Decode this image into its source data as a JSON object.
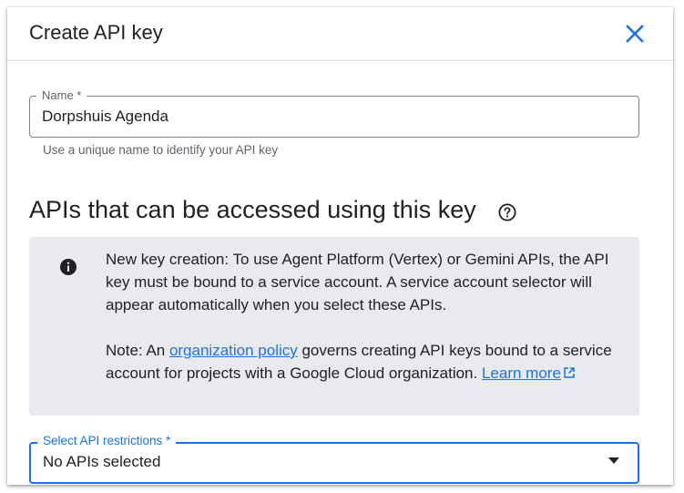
{
  "dialog": {
    "title": "Create API key"
  },
  "name_field": {
    "label": "Name *",
    "value": "Dorpshuis Agenda",
    "helper": "Use a unique name to identify your API key"
  },
  "section": {
    "title": "APIs that can be accessed using this key"
  },
  "info": {
    "paragraph1": "New key creation: To use Agent Platform (Vertex) or Gemini APIs, the API key must be bound to a service account. A service account selector will appear automatically when you select these APIs.",
    "note_prefix": "Note: An ",
    "policy_link": "organization policy",
    "note_middle": " governs creating API keys bound to a service account for projects with a Google Cloud organization. ",
    "learn_more_link": "Learn more"
  },
  "restrictions": {
    "label": "Select API restrictions *",
    "value": "No APIs selected"
  },
  "colors": {
    "accent": "#1a73e8",
    "text": "#202124",
    "secondary_text": "#5f6368",
    "info_background": "#e8eaed"
  },
  "icons": {
    "close": "close-icon",
    "help": "help-circle-icon",
    "info": "info-icon",
    "external_link": "external-link-icon",
    "dropdown": "dropdown-arrow-icon"
  }
}
